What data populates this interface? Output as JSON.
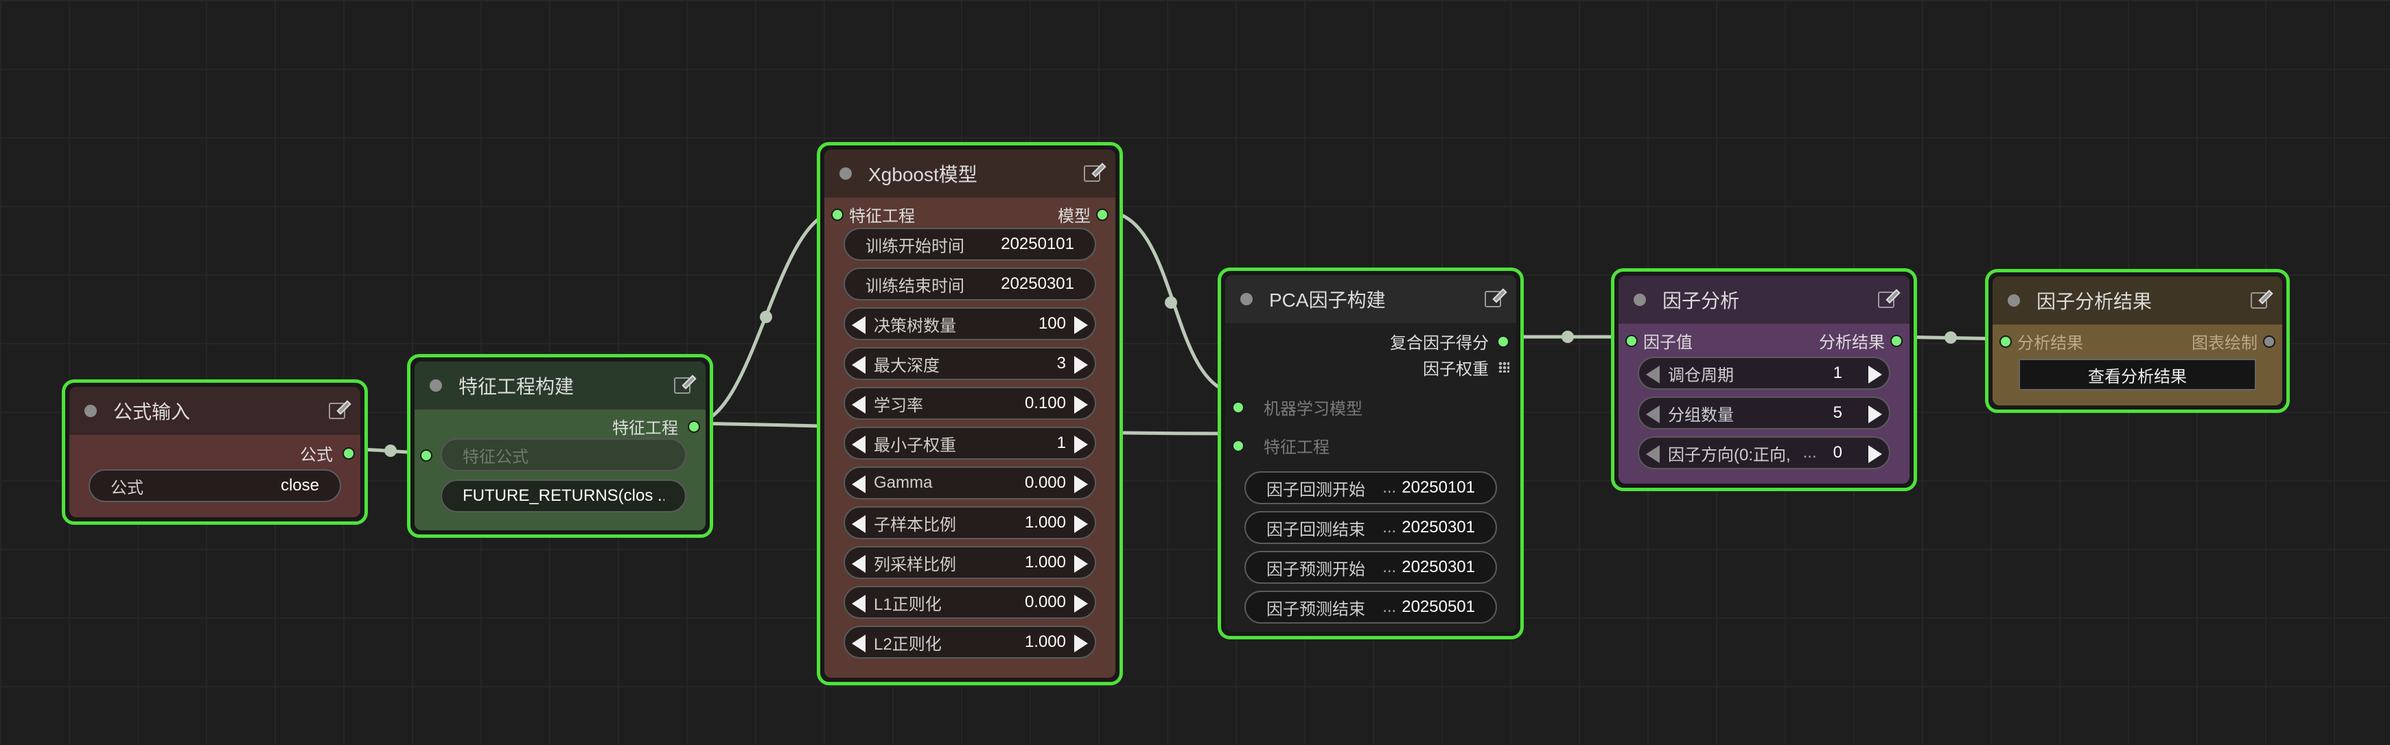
{
  "nodes": {
    "formula_input": {
      "title": "公式输入",
      "output_label": "公式",
      "widget_label": "公式",
      "widget_value": "close",
      "colors": {
        "title": "#3a2727",
        "body": "#5b3434"
      }
    },
    "feature_build": {
      "title": "特征工程构建",
      "output_label": "特征工程",
      "input_placeholder": "特征公式",
      "widget_value": "FUTURE_RETURNS(clos ...",
      "colors": {
        "title": "#2a3a2a",
        "body": "#3f5c3a"
      }
    },
    "xgboost": {
      "title": "Xgboost模型",
      "input_label": "特征工程",
      "output_label": "模型",
      "params": [
        {
          "label": "训练开始时间",
          "value": "20250101",
          "kind": "text"
        },
        {
          "label": "训练结束时间",
          "value": "20250301",
          "kind": "text"
        },
        {
          "label": "决策树数量",
          "value": "100",
          "kind": "number"
        },
        {
          "label": "最大深度",
          "value": "3",
          "kind": "number"
        },
        {
          "label": "学习率",
          "value": "0.100",
          "kind": "number"
        },
        {
          "label": "最小子权重",
          "value": "1",
          "kind": "number"
        },
        {
          "label": "Gamma",
          "value": "0.000",
          "kind": "number"
        },
        {
          "label": "子样本比例",
          "value": "1.000",
          "kind": "number"
        },
        {
          "label": "列采样比例",
          "value": "1.000",
          "kind": "number"
        },
        {
          "label": "L1正则化",
          "value": "0.000",
          "kind": "number"
        },
        {
          "label": "L2正则化",
          "value": "1.000",
          "kind": "number"
        }
      ],
      "colors": {
        "title": "#3a2a26",
        "body": "#5a3a33"
      }
    },
    "pca": {
      "title": "PCA因子构建",
      "outputs": [
        "复合因子得分",
        "因子权重"
      ],
      "inputs": [
        "机器学习模型",
        "特征工程"
      ],
      "params": [
        {
          "label": "因子回测开始",
          "value": "20250101"
        },
        {
          "label": "因子回测结束",
          "value": "20250301"
        },
        {
          "label": "因子预测开始",
          "value": "20250301"
        },
        {
          "label": "因子预测结束",
          "value": "20250501"
        }
      ],
      "colors": {
        "title": "#2a2a2a",
        "body": "#1f1f1f"
      }
    },
    "factor_analysis": {
      "title": "因子分析",
      "input_label": "因子值",
      "output_label": "分析结果",
      "params": [
        {
          "label": "调仓周期",
          "value": "1"
        },
        {
          "label": "分组数量",
          "value": "5"
        },
        {
          "label": "因子方向(0:正向,",
          "value": "0"
        }
      ],
      "colors": {
        "title": "#3a2a3e",
        "body": "#5a3c63"
      }
    },
    "result": {
      "title": "因子分析结果",
      "input_label": "分析结果",
      "output_label": "图表绘制",
      "button_label": "查看分析结果",
      "colors": {
        "title": "#3e3524",
        "body": "#6f5c36"
      }
    }
  },
  "colors": {
    "selection_border": "#4ee23a",
    "port": "#7bf07b",
    "wire": "#b9c9b5",
    "canvas": "#1e1e1e"
  }
}
